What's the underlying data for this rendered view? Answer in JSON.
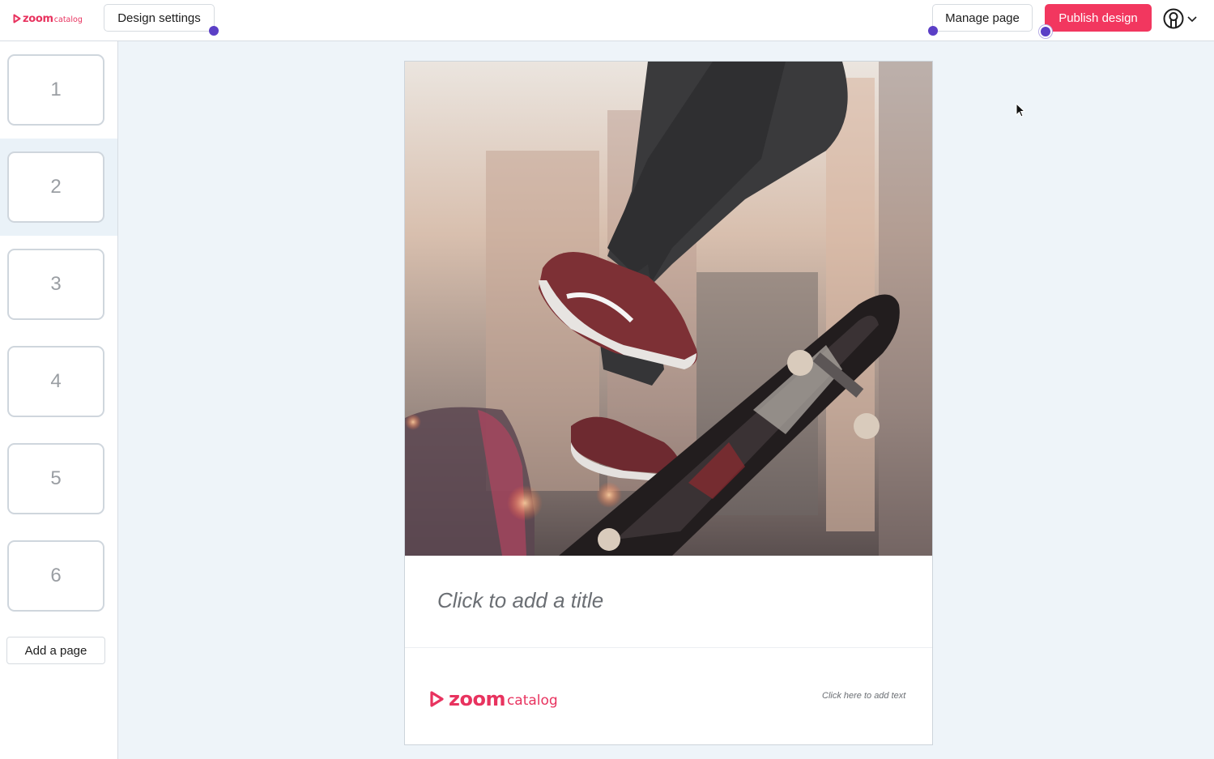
{
  "header": {
    "logo": {
      "brand": "zoom",
      "sub": "catalog"
    },
    "design_settings_label": "Design settings",
    "manage_page_label": "Manage page",
    "publish_label": "Publish design",
    "accent_color": "#f2375f"
  },
  "sidebar": {
    "pages": [
      {
        "label": "1"
      },
      {
        "label": "2",
        "active": true
      },
      {
        "label": "3"
      },
      {
        "label": "4"
      },
      {
        "label": "5"
      },
      {
        "label": "6"
      }
    ],
    "add_page_label": "Add a page"
  },
  "canvas": {
    "title_placeholder": "Click to add a title",
    "footer_logo": {
      "brand": "zoom",
      "sub": "catalog"
    },
    "footer_text_placeholder": "Click here to add text"
  }
}
